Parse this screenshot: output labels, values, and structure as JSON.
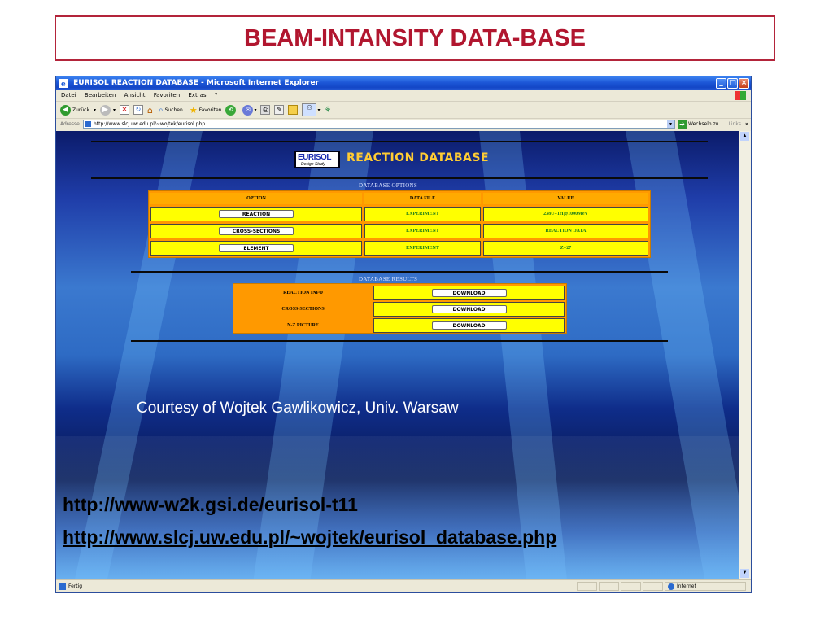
{
  "slide": {
    "title": "BEAM-INTANSITY DATA-BASE",
    "courtesy": "Courtesy of Wojtek Gawlikowicz, Univ. Warsaw",
    "links": [
      "http://www-w2k.gsi.de/eurisol-t11",
      "http://www.slcj.uw.edu.pl/~wojtek/eurisol_database.php"
    ]
  },
  "browser": {
    "window_title": "EURISOL REACTION DATABASE - Microsoft Internet Explorer",
    "menu": [
      "Datei",
      "Bearbeiten",
      "Ansicht",
      "Favoriten",
      "Extras",
      "?"
    ],
    "toolbar": {
      "back": "Zurück",
      "search": "Suchen",
      "favorites": "Favoriten"
    },
    "address": {
      "label": "Adresse",
      "url": "http://www.slcj.uw.edu.pl/~wojtek/eurisol.php",
      "go": "Wechseln zu",
      "links": "Links"
    },
    "status": {
      "left": "Fertig",
      "zone": "Internet"
    }
  },
  "page": {
    "logo_top": "EURISOL",
    "logo_bottom": "Design Study",
    "app_title": "REACTION DATABASE",
    "options": {
      "label": "DATABASE OPTIONS",
      "headers": [
        "OPTION",
        "DATA FILE",
        "VALUE"
      ],
      "rows": [
        {
          "option": "REACTION",
          "file": "EXPERIMENT",
          "value": "238U+1H@1000MeV"
        },
        {
          "option": "CROSS-SECTIONS",
          "file": "EXPERIMENT",
          "value": "REACTION DATA"
        },
        {
          "option": "ELEMENT",
          "file": "EXPERIMENT",
          "value": "Z=27"
        }
      ]
    },
    "results": {
      "label": "DATABASE RESULTS",
      "rows": [
        {
          "name": "REACTION INFO",
          "action": "DOWNLOAD"
        },
        {
          "name": "CROSS-SECTIONS",
          "action": "DOWNLOAD"
        },
        {
          "name": "N-Z PICTURE",
          "action": "DOWNLOAD"
        }
      ]
    }
  },
  "colors": {
    "title_red": "#b1162f",
    "table_orange": "#ff9900",
    "cell_yellow": "#ffff00",
    "value_green": "#1a7a1a"
  }
}
